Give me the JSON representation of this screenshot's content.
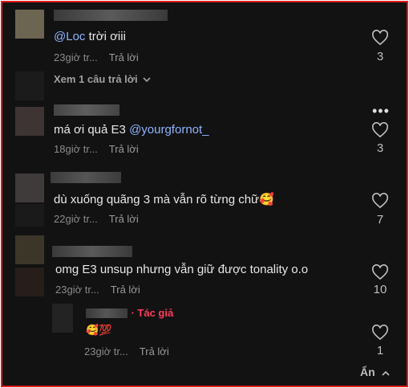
{
  "comments": [
    {
      "text_prefix": "",
      "mention": "@Loc",
      "text_suffix": " trời ơiii",
      "time": "23giờ tr...",
      "reply": "Trả lời",
      "likes": "3",
      "view_replies": "Xem 1 câu trả lời"
    },
    {
      "text_prefix": "má ơi quả E3 ",
      "mention": "@yourgfornot_",
      "text_suffix": "",
      "time": "18giờ tr...",
      "reply": "Trả lời",
      "likes": "3"
    },
    {
      "text_prefix": "dù xuống quãng 3 mà vẫn rõ từng chữ🥰",
      "mention": "",
      "text_suffix": "",
      "time": "22giờ tr...",
      "reply": "Trả lời",
      "likes": "7"
    },
    {
      "text_prefix": "omg E3 unsup nhưng vẫn giữ được tonality o.o",
      "mention": "",
      "text_suffix": "",
      "time": "23giờ tr...",
      "reply": "Trả lời",
      "likes": "10"
    }
  ],
  "reply": {
    "author_tag": "· Tác giả",
    "text": "🥰💯",
    "time": "23giờ tr...",
    "reply": "Trả lời",
    "likes": "1"
  },
  "more_icon": "more-dots-icon",
  "hide_label": "Ẩn",
  "colors": {
    "mention": "#8fb3ff",
    "author": "#ff3b5c",
    "border": "#e01d1d"
  }
}
